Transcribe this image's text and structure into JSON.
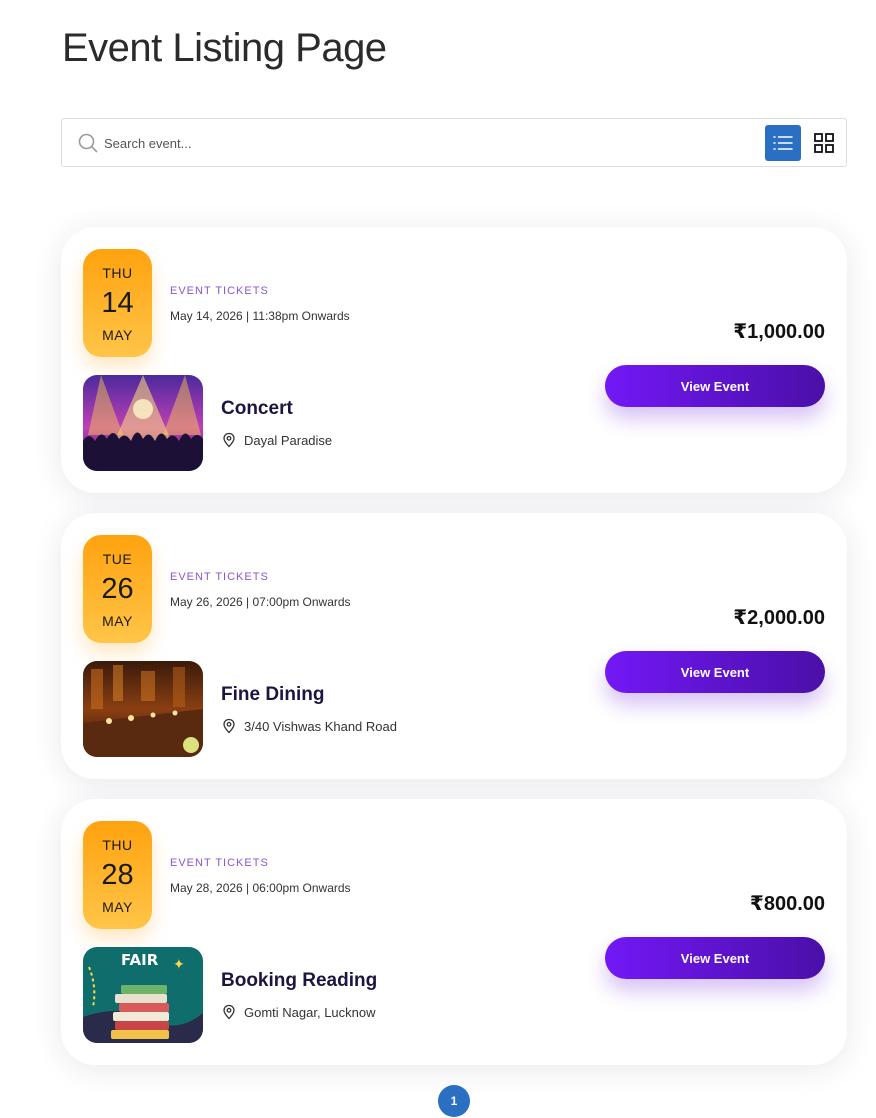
{
  "page": {
    "title": "Event Listing Page"
  },
  "search": {
    "placeholder": "Search event..."
  },
  "view_toggle": {
    "active": "list",
    "icons": [
      "list-view-icon",
      "grid-view-icon"
    ]
  },
  "colors": {
    "accent": "#2a6fc2",
    "badge_gradient": [
      "#ffa20f",
      "#ffc548"
    ],
    "button_gradient": [
      "#7318f5",
      "#4a0fa8"
    ],
    "category": "#8a55d6"
  },
  "events": [
    {
      "dow": "THU",
      "day": "14",
      "month": "MAY",
      "category": "EVENT TICKETS",
      "datetime": "May 14, 2026 | 11:38pm Onwards",
      "price": "₹1,000.00",
      "button": "View Event",
      "name": "Concert",
      "location": "Dayal Paradise",
      "image": "concert-crowd-image"
    },
    {
      "dow": "TUE",
      "day": "26",
      "month": "MAY",
      "category": "EVENT TICKETS",
      "datetime": "May 26, 2026 | 07:00pm Onwards",
      "price": "₹2,000.00",
      "button": "View Event",
      "name": "Fine Dining",
      "location": "3/40 Vishwas Khand Road",
      "image": "dining-hall-image"
    },
    {
      "dow": "THU",
      "day": "28",
      "month": "MAY",
      "category": "EVENT TICKETS",
      "datetime": "May 28, 2026 | 06:00pm Onwards",
      "price": "₹800.00",
      "button": "View Event",
      "name": "Booking Reading",
      "location": "Gomti Nagar, Lucknow",
      "image": "book-fair-image",
      "image_text": "FAIR"
    }
  ],
  "pagination": {
    "current": "1"
  }
}
